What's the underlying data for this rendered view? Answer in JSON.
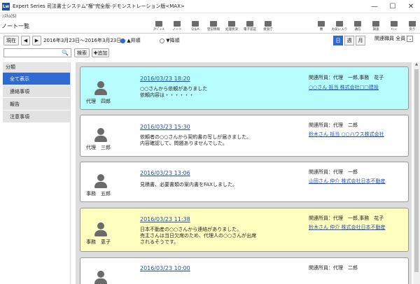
{
  "window": {
    "app_icon": "Lw",
    "title": "Expert Series 司法書士システム\"権\"完全版-デモンストレーション版<MAX>",
    "minimize": "—",
    "maximize": "☐",
    "close": "✕"
  },
  "menubar": {
    "system_menu": "ｼｽﾃﾑ(S)"
  },
  "toolbar": {
    "page_title": "ノート一覧",
    "tools": [
      {
        "label": "ｽｹｼﾞｭｰﾙ",
        "icon": "schedule-icon"
      },
      {
        "label": "ノート",
        "icon": "note-icon"
      },
      {
        "label": "Q＆A",
        "icon": "qa-icon"
      },
      {
        "label": "登記情報",
        "icon": "registry-icon"
      },
      {
        "label": "処理状況",
        "icon": "status-icon"
      },
      {
        "label": "電子認証",
        "icon": "certificate-icon"
      },
      {
        "label": "接受庁",
        "icon": "office-icon"
      }
    ],
    "tools_right": [
      {
        "label": "暦",
        "icon": "calendar-icon"
      },
      {
        "label": "お気に入り",
        "icon": "favorites-icon"
      },
      {
        "label": "通信",
        "icon": "communication-icon"
      },
      {
        "label": "調査",
        "icon": "survey-icon"
      },
      {
        "label": "ﾒﾆｭｰ",
        "icon": "menu-icon"
      },
      {
        "label": "戻り",
        "icon": "back-icon"
      }
    ]
  },
  "filters": {
    "today_label": "現在",
    "prev": "◀",
    "next": "▶",
    "date_range": "2016年3月23日～2016年3月23日",
    "sort_asc": "▲昇順",
    "sort_desc": "▼降順",
    "sort_selected": "asc",
    "view_day": "日",
    "view_week": "週",
    "view_month": "月",
    "view_selected": "day",
    "staff_label": "関連職員",
    "staff_value": "全員",
    "staff_dropdown": "⌄",
    "search_value": "",
    "search_icon": "🔍",
    "search_button": "検索",
    "add_button": "✚追加"
  },
  "sidebar": {
    "header": "分類",
    "items": [
      {
        "label": "全て表示",
        "active": true
      },
      {
        "label": "連絡事項",
        "active": false
      },
      {
        "label": "報告",
        "active": false
      },
      {
        "label": "注意事項",
        "active": false
      }
    ]
  },
  "colors": {
    "accent": "#2f6ad0",
    "link": "#1f4eb8",
    "card_cyan": "#b8fdfd",
    "card_yellow": "#ffffc0"
  },
  "notes": [
    {
      "author": "代理　四郎",
      "datetime": "2016/03/23 18:20",
      "message": "○○さんから依頼がありました\n依頼内容は・・・・・・",
      "related": "関連所員：代理　一郎,事務　花子",
      "related_link": "○○さん 抵当 株式会社□□建設",
      "color": "cyan"
    },
    {
      "author": "代理　三郎",
      "datetime": "2016/03/23 15:30",
      "message": "依頼者の○○さんから契約書の写しが届きました。\n内容確認して、問題ありませんでした。",
      "related": "関連所員：代理　二郎",
      "related_link": "鈴木さん 抵当 ○○ハウス株式会社",
      "color": "white"
    },
    {
      "author": "事務　五郎",
      "datetime": "2016/03/23 13:06",
      "message": "見積書、必要書類の案内書をFAXしました。",
      "related": "関連所員：代理　一郎",
      "related_link": "山田さん 仲介 株式会社日本不動産",
      "color": "white"
    },
    {
      "author": "事務　恵子",
      "datetime": "2016/03/23 11:38",
      "message": "日本不動産の○○さんから連絡がありました。\n売主さんは当日欠席のため、代理人の○○さんが出席\nされるそうです。",
      "related": "関連所員：代理　一郎,事務　花子",
      "related_link": "鈴木さん 仲介 株式会社日本不動産",
      "color": "yellow"
    },
    {
      "author": "",
      "datetime": "2016/03/23 10:00",
      "message": "",
      "related": "関連所員：代理　二郎",
      "related_link": "",
      "color": "white"
    }
  ],
  "scrollbar": {
    "up": "▲",
    "down": "▼"
  }
}
